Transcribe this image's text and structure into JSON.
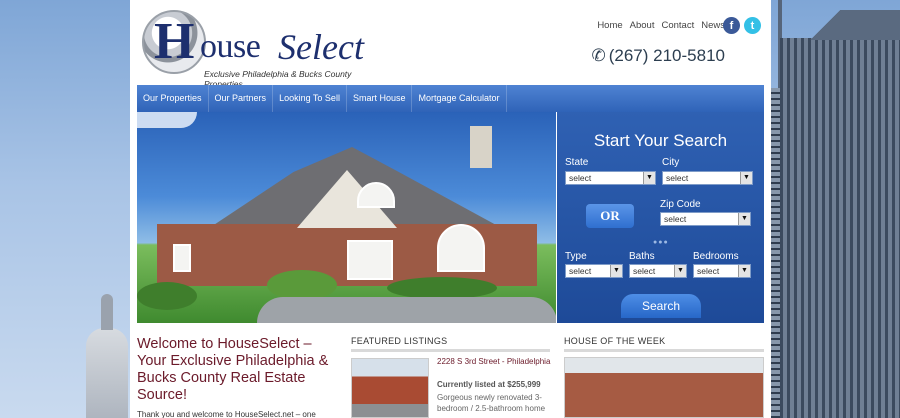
{
  "brand": {
    "logo_h": "H",
    "logo_word1": "ouse",
    "logo_word2": "Select",
    "tagline": "Exclusive Philadelphia & Bucks County Properties"
  },
  "topnav": [
    "Home",
    "About",
    "Contact",
    "News"
  ],
  "social": {
    "facebook": "f",
    "twitter": "t"
  },
  "phone": "(267) 210-5810",
  "mainnav": [
    "Our Properties",
    "Our Partners",
    "Looking To Sell",
    "Smart House",
    "Mortgage Calculator"
  ],
  "search": {
    "title": "Start Your Search",
    "state_label": "State",
    "state_value": "select",
    "city_label": "City",
    "city_value": "select",
    "or_label": "OR",
    "zip_label": "Zip Code",
    "zip_value": "select",
    "type_label": "Type",
    "type_value": "select",
    "baths_label": "Baths",
    "baths_value": "select",
    "bedrooms_label": "Bedrooms",
    "bedrooms_value": "select",
    "submit_label": "Search"
  },
  "welcome": {
    "heading": "Welcome to HouseSelect – Your Exclusive Philadelphia & Bucks County Real Estate Source!",
    "text": "Thank you and welcome to HouseSelect.net – one"
  },
  "featured": {
    "title": "FEATURED LISTINGS",
    "listing_title": "2228 S 3rd Street - Philadelphia",
    "listing_price": "Currently listed at $255,999",
    "listing_desc": "Gorgeous newly renovated 3-bedroom / 2.5-bathroom home"
  },
  "house_of_week": {
    "title": "HOUSE OF THE WEEK"
  },
  "colors": {
    "nav": "#2f63b8",
    "search_bg": "#1e4a98",
    "heading": "#6b1a2a"
  }
}
